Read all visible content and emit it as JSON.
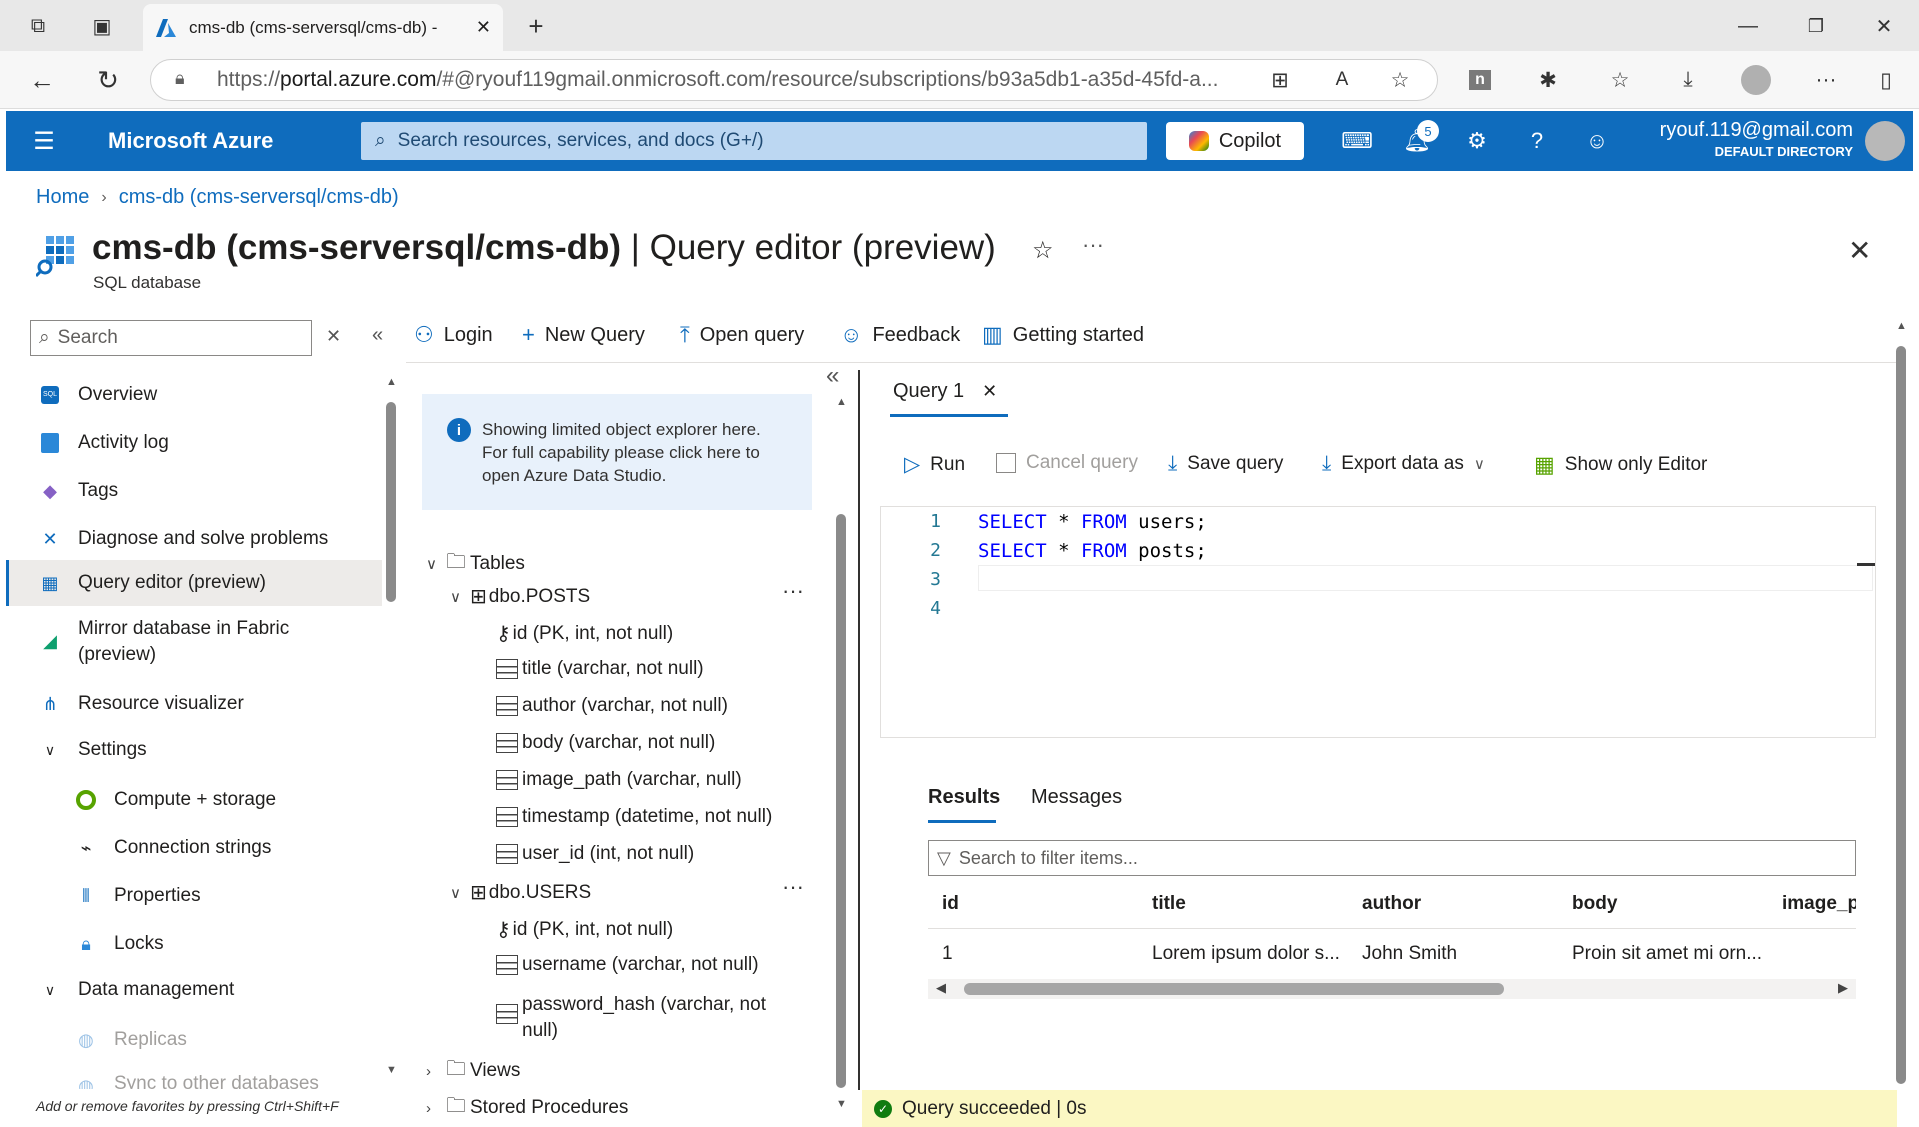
{
  "browser": {
    "tab_title": "cms-db (cms-serversql/cms-db) -",
    "url_prefix": "https://",
    "url_host": "portal.azure.com",
    "url_rest": "/#@ryouf119gmail.onmicrosoft.com/resource/subscriptions/b93a5db1-a35d-45fd-a..."
  },
  "azure_header": {
    "brand": "Microsoft Azure",
    "search_placeholder": "Search resources, services, and docs (G+/)",
    "copilot_label": "Copilot",
    "notification_count": "5",
    "account_email": "ryouf.119@gmail.com",
    "account_directory": "DEFAULT DIRECTORY"
  },
  "breadcrumb": [
    "Home",
    "cms-db (cms-serversql/cms-db)"
  ],
  "page": {
    "title_bold": "cms-db (cms-serversql/cms-db)",
    "title_rest": " | Query editor (preview)",
    "subtitle": "SQL database"
  },
  "nav": {
    "search_placeholder": "Search",
    "items": [
      {
        "label": "Overview",
        "icon": "sql-icon"
      },
      {
        "label": "Activity log",
        "icon": "activity-log-icon"
      },
      {
        "label": "Tags",
        "icon": "tag-icon"
      },
      {
        "label": "Diagnose and solve problems",
        "icon": "wrench-icon"
      },
      {
        "label": "Query editor (preview)",
        "icon": "query-editor-icon"
      },
      {
        "label": "Mirror database in Fabric",
        "label2": "(preview)",
        "icon": "fabric-icon"
      },
      {
        "label": "Resource visualizer",
        "icon": "visualizer-icon"
      },
      {
        "label": "Settings",
        "icon": "chevron-down-icon"
      },
      {
        "label": "Compute + storage",
        "icon": "compute-icon"
      },
      {
        "label": "Connection strings",
        "icon": "plug-icon"
      },
      {
        "label": "Properties",
        "icon": "properties-icon"
      },
      {
        "label": "Locks",
        "icon": "lock-icon"
      },
      {
        "label": "Data management",
        "icon": "chevron-down-icon"
      },
      {
        "label": "Replicas",
        "icon": "globe-icon"
      },
      {
        "label": "Sync to other databases",
        "icon": "sync-icon"
      }
    ],
    "footer": "Add or remove favorites by pressing Ctrl+Shift+F"
  },
  "toolbar": {
    "login": "Login",
    "new_query": "New Query",
    "open_query": "Open query",
    "feedback": "Feedback",
    "getting_started": "Getting started"
  },
  "explorer": {
    "info": [
      "Showing limited object explorer here.",
      "For full capability please click here to",
      "open Azure Data Studio."
    ],
    "tables_label": "Tables",
    "tables": [
      {
        "name": "dbo.POSTS",
        "columns": [
          "id (PK, int, not null)",
          "title (varchar, not null)",
          "author (varchar, not null)",
          "body (varchar, not null)",
          "image_path (varchar, null)",
          "timestamp (datetime, not null)",
          "user_id (int, not null)"
        ]
      },
      {
        "name": "dbo.USERS",
        "columns": [
          "id (PK, int, not null)",
          "username (varchar, not null)",
          "password_hash (varchar, not",
          "null)"
        ]
      }
    ],
    "views_label": "Views",
    "procs_label": "Stored Procedures"
  },
  "query": {
    "tab_label": "Query 1",
    "run": "Run",
    "cancel": "Cancel query",
    "save": "Save query",
    "export": "Export data as",
    "show_editor": "Show only Editor",
    "lines": [
      {
        "num": "1",
        "kw1": "SELECT",
        "star": " * ",
        "kw2": "FROM",
        "rest": " users;"
      },
      {
        "num": "2",
        "kw1": "SELECT",
        "star": " * ",
        "kw2": "FROM",
        "rest": " posts;"
      },
      {
        "num": "3"
      },
      {
        "num": "4"
      }
    ]
  },
  "results": {
    "tab_results": "Results",
    "tab_messages": "Messages",
    "filter_placeholder": "Search to filter items...",
    "columns": [
      "id",
      "title",
      "author",
      "body",
      "image_p"
    ],
    "rows": [
      [
        "1",
        "Lorem ipsum dolor s...",
        "John Smith",
        "Proin sit amet mi orn...",
        ""
      ]
    ]
  },
  "status": {
    "text": "Query succeeded | 0s",
    "color": "#fbf7c3"
  },
  "colors": {
    "azure_blue": "#0f6cbd",
    "accent": "#0f6cbd"
  }
}
